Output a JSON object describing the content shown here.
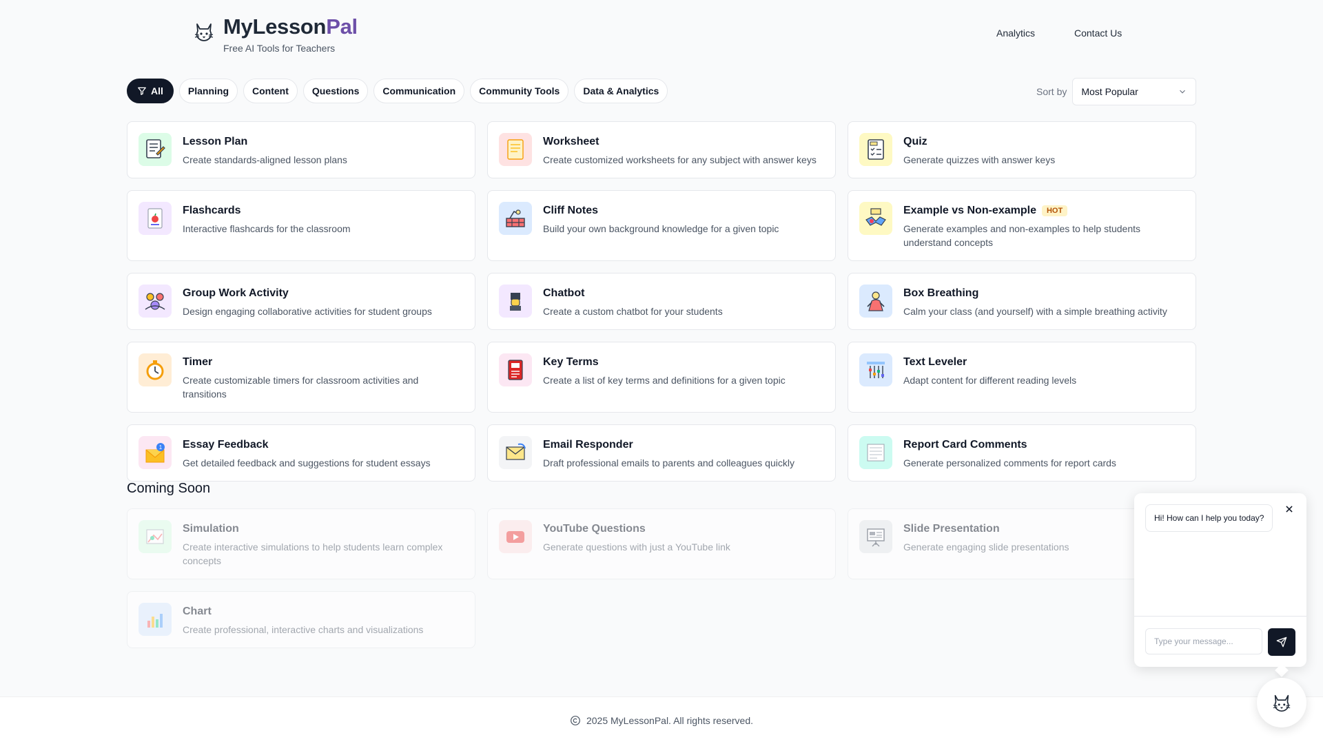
{
  "header": {
    "brand_part1": "MyLesson",
    "brand_part2": "Pal",
    "tagline": "Free AI Tools for Teachers",
    "nav": [
      "Analytics",
      "Contact Us"
    ]
  },
  "filters": {
    "chips": [
      "All",
      "Planning",
      "Content",
      "Questions",
      "Communication",
      "Community Tools",
      "Data & Analytics"
    ],
    "active": "All",
    "sort_label": "Sort by",
    "sort_value": "Most Popular"
  },
  "tools": [
    {
      "title": "Lesson Plan",
      "desc": "Create standards-aligned lesson plans",
      "icon": "lesson-plan-icon",
      "bg": "#dcfce7"
    },
    {
      "title": "Worksheet",
      "desc": "Create customized worksheets for any subject with answer keys",
      "icon": "worksheet-icon",
      "bg": "#fee2e2"
    },
    {
      "title": "Quiz",
      "desc": "Generate quizzes with answer keys",
      "icon": "quiz-icon",
      "bg": "#fef9c3"
    },
    {
      "title": "Flashcards",
      "desc": "Interactive flashcards for the classroom",
      "icon": "flashcards-icon",
      "bg": "#f3e8ff"
    },
    {
      "title": "Cliff Notes",
      "desc": "Build your own background knowledge for a given topic",
      "icon": "cliff-notes-icon",
      "bg": "#dbeafe"
    },
    {
      "title": "Example vs Non-example",
      "badge": "HOT",
      "desc": "Generate examples and non-examples to help students understand concepts",
      "icon": "example-icon",
      "bg": "#fef9c3"
    },
    {
      "title": "Group Work Activity",
      "desc": "Design engaging collaborative activities for student groups",
      "icon": "group-work-icon",
      "bg": "#f3e8ff"
    },
    {
      "title": "Chatbot",
      "desc": "Create a custom chatbot for your students",
      "icon": "chatbot-icon",
      "bg": "#f3e8ff"
    },
    {
      "title": "Box Breathing",
      "desc": "Calm your class (and yourself) with a simple breathing activity",
      "icon": "box-breathing-icon",
      "bg": "#dbeafe"
    },
    {
      "title": "Timer",
      "desc": "Create customizable timers for classroom activities and transitions",
      "icon": "timer-icon",
      "bg": "#ffedd5"
    },
    {
      "title": "Key Terms",
      "desc": "Create a list of key terms and definitions for a given topic",
      "icon": "key-terms-icon",
      "bg": "#fce7f3"
    },
    {
      "title": "Text Leveler",
      "desc": "Adapt content for different reading levels",
      "icon": "text-leveler-icon",
      "bg": "#dbeafe"
    },
    {
      "title": "Essay Feedback",
      "desc": "Get detailed feedback and suggestions for student essays",
      "icon": "essay-feedback-icon",
      "bg": "#fce7f3"
    },
    {
      "title": "Email Responder",
      "desc": "Draft professional emails to parents and colleagues quickly",
      "icon": "email-responder-icon",
      "bg": "#f3f4f6"
    },
    {
      "title": "Report Card Comments",
      "desc": "Generate personalized comments for report cards",
      "icon": "report-card-icon",
      "bg": "#ccfbf1"
    }
  ],
  "coming_soon": {
    "title": "Coming Soon",
    "tools": [
      {
        "title": "Simulation",
        "desc": "Create interactive simulations to help students learn complex concepts",
        "icon": "simulation-icon",
        "bg": "#dcfce7"
      },
      {
        "title": "YouTube Questions",
        "desc": "Generate questions with just a YouTube link",
        "icon": "youtube-icon",
        "bg": "#fee2e2"
      },
      {
        "title": "Slide Presentation",
        "desc": "Generate engaging slide presentations",
        "icon": "slide-presentation-icon",
        "bg": "#e5e7eb"
      },
      {
        "title": "Chart",
        "desc": "Create professional, interactive charts and visualizations",
        "icon": "chart-icon",
        "bg": "#dbeafe"
      }
    ]
  },
  "footer": {
    "text": "2025 MyLessonPal. All rights reserved."
  },
  "chat": {
    "greeting": "Hi! How can I help you today?",
    "placeholder": "Type your message..."
  }
}
